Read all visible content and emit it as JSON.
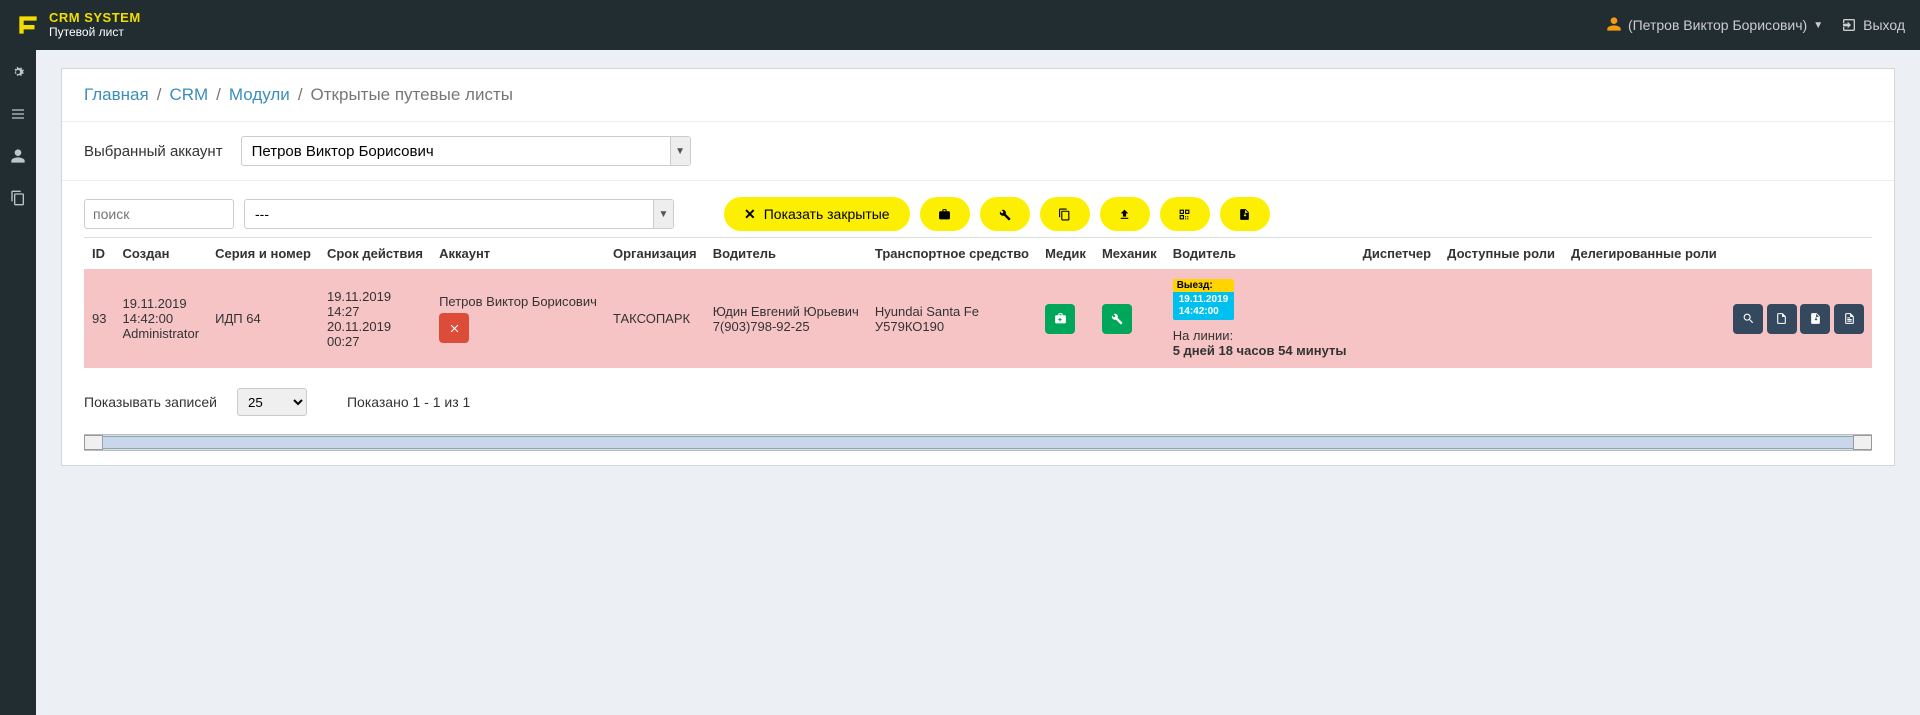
{
  "brand": {
    "title": "CRM SYSTEM",
    "subtitle": "Путевой лист"
  },
  "topuser": {
    "name": "(Петров Виктор Борисович)"
  },
  "signout": "Выход",
  "breadcrumb": {
    "items": [
      "Главная",
      "CRM",
      "Модули"
    ],
    "current": "Открытые путевые листы"
  },
  "account": {
    "label": "Выбранный аккаунт",
    "value": "Петров Виктор Борисович"
  },
  "search": {
    "placeholder": "поиск"
  },
  "filter_select": {
    "value": "---"
  },
  "show_closed_btn": "Показать закрытые",
  "columns": {
    "id": "ID",
    "created": "Создан",
    "series": "Серия и номер",
    "validity": "Срок действия",
    "account": "Аккаунт",
    "org": "Организация",
    "driver": "Водитель",
    "vehicle": "Транспортное средство",
    "medic": "Медик",
    "mechanic": "Механик",
    "driver2": "Водитель",
    "dispatcher": "Диспетчер",
    "avail_roles": "Доступные роли",
    "deleg_roles": "Делегированные роли"
  },
  "row": {
    "id": "93",
    "created_l1": "19.11.2019",
    "created_l2": "14:42:00",
    "created_l3": "Administrator",
    "series": "ИДП 64",
    "valid_l1": "19.11.2019",
    "valid_l2": "14:27",
    "valid_l3": "20.11.2019",
    "valid_l4": "00:27",
    "account": "Петров Виктор Борисович",
    "org": "ТАКСОПАРК",
    "driver_l1": "Юдин Евгений Юрьевич",
    "driver_l2": "7(903)798-92-25",
    "vehicle_l1": "Hyundai Santa Fe",
    "vehicle_l2": "У579КО190",
    "badge_top": "Выезд:",
    "badge_b1": "19.11.2019",
    "badge_b2": "14:42:00",
    "online_label": "На линии:",
    "online_value": "5 дней 18 часов 54 минуты"
  },
  "footer": {
    "perpage_label": "Показывать записей",
    "perpage_value": "25",
    "shown": "Показано 1 - 1 из 1"
  }
}
